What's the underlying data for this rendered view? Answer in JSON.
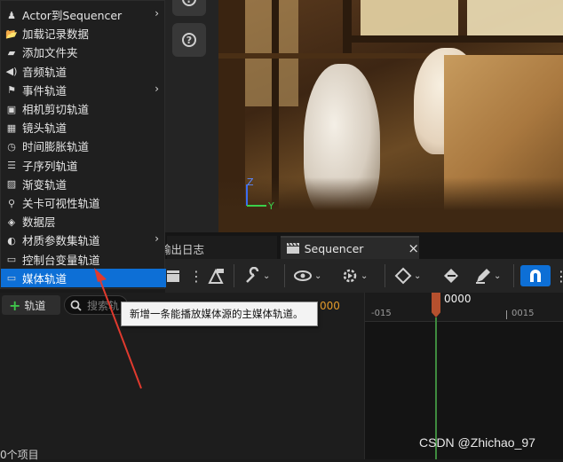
{
  "menu": {
    "items": [
      {
        "label": "Actor到Sequencer",
        "icon": "actor-icon",
        "submenu": true
      },
      {
        "label": "加载记录数据",
        "icon": "folder-open-icon",
        "submenu": false
      },
      {
        "label": "添加文件夹",
        "icon": "folder-icon",
        "submenu": false
      },
      {
        "label": "音频轨道",
        "icon": "speaker-icon",
        "submenu": false
      },
      {
        "label": "事件轨道",
        "icon": "flag-icon",
        "submenu": true
      },
      {
        "label": "相机剪切轨道",
        "icon": "camera-cut-icon",
        "submenu": false
      },
      {
        "label": "镜头轨道",
        "icon": "film-icon",
        "submenu": false
      },
      {
        "label": "时间膨胀轨道",
        "icon": "clock-icon",
        "submenu": false
      },
      {
        "label": "子序列轨道",
        "icon": "subsequence-icon",
        "submenu": false
      },
      {
        "label": "渐变轨道",
        "icon": "fade-icon",
        "submenu": false
      },
      {
        "label": "关卡可视性轨道",
        "icon": "level-visibility-icon",
        "submenu": false
      },
      {
        "label": "数据层",
        "icon": "layers-icon",
        "submenu": false
      },
      {
        "label": "材质参数集轨道",
        "icon": "material-icon",
        "submenu": true
      },
      {
        "label": "控制台变量轨道",
        "icon": "console-icon",
        "submenu": false
      },
      {
        "label": "媒体轨道",
        "icon": "tv-icon",
        "submenu": false,
        "selected": true
      }
    ]
  },
  "tooltip": {
    "text": "新增一条能播放媒体源的主媒体轨道。"
  },
  "tabs": {
    "log_label": "输出日志",
    "sequencer_label": "Sequencer",
    "close_glyph": "×"
  },
  "track_bar": {
    "add_label": "轨道",
    "search_placeholder": "搜索轨"
  },
  "timeline": {
    "current_frame": "0000",
    "tick_left": "-015",
    "tick_right": "0015",
    "side_frame": "000"
  },
  "status": {
    "item_count": "0个项目"
  },
  "viewport": {
    "axis_z": "Z",
    "axis_y": "Y"
  },
  "watermark": "CSDN @Zhichao_97",
  "colors": {
    "accent": "#0d6fd6",
    "playhead": "#b5502e",
    "magnet": "#0d6fd6",
    "frame_orange": "#e39b2b"
  }
}
